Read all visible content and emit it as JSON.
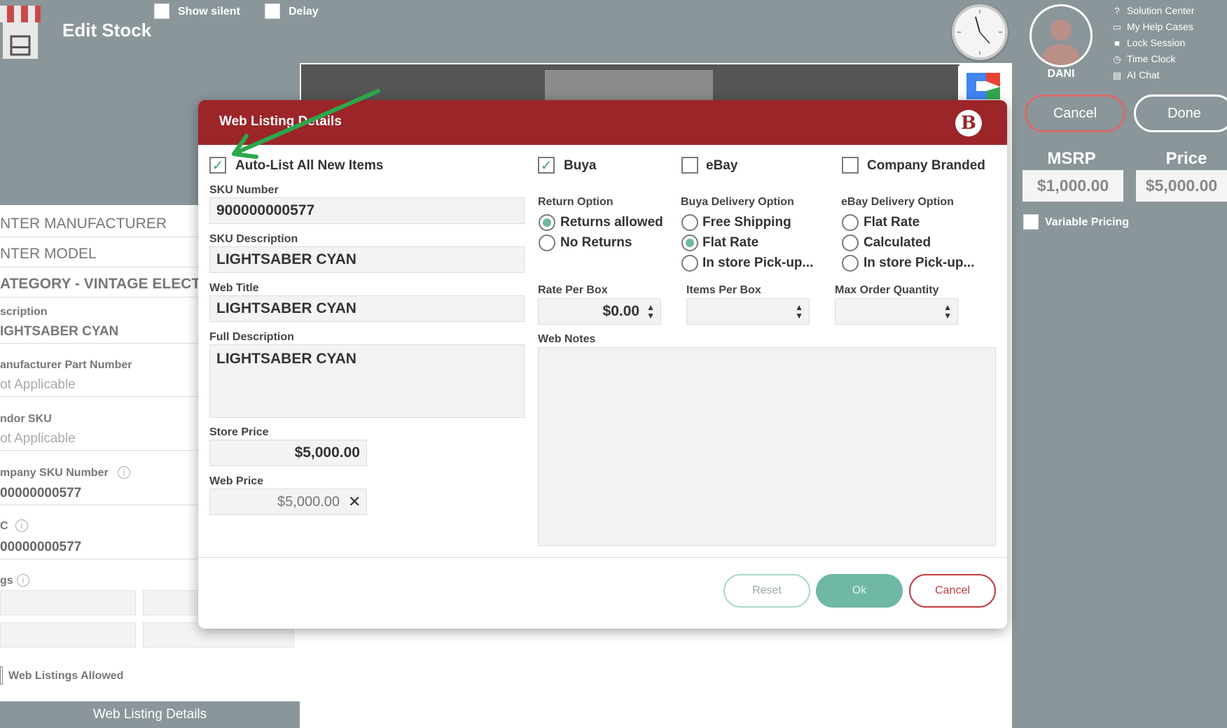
{
  "topbar": {
    "title": "Edit Stock",
    "show_silent_label": "Show silent",
    "delay_label": "Delay",
    "user_name": "DANI",
    "help_links": [
      "Solution Center",
      "My Help Cases",
      "Lock Session",
      "Time Clock",
      "AI Chat"
    ],
    "cancel_label": "Cancel",
    "done_label": "Done",
    "msrp_label": "MSRP",
    "msrp_value": "$1,000.00",
    "price_label": "Price",
    "price_value": "$5,000.00",
    "variable_pricing_label": "Variable Pricing"
  },
  "background_form": {
    "manufacturer": "NTER MANUFACTURER",
    "model": "NTER MODEL",
    "category": "ATEGORY - VINTAGE ELECTRONICS",
    "description_label": "scription",
    "description_value": "IGHTSABER  CYAN",
    "mpn_label": "anufacturer Part Number",
    "mpn_value": "ot Applicable",
    "vendor_sku_label": "ndor SKU",
    "vendor_sku_value": "ot Applicable",
    "company_sku_label": "mpany SKU Number",
    "company_sku_value": "00000000577",
    "upc_label": "C",
    "upc_value": "00000000577",
    "tags_label": "gs",
    "web_listings_label": "Web Listings Allowed",
    "web_listing_details_btn": "Web Listing Details"
  },
  "modal": {
    "title": "Web Listing Details",
    "logo_letter": "B",
    "auto_list_label": "Auto-List All New Items",
    "auto_list_checked": true,
    "buya_label": "Buya",
    "ebay_label": "eBay",
    "company_branded_label": "Company Branded",
    "sku_number_label": "SKU Number",
    "sku_number_value": "900000000577",
    "sku_desc_label": "SKU Description",
    "sku_desc_value": "LIGHTSABER  CYAN",
    "web_title_label": "Web Title",
    "web_title_value": "LIGHTSABER  CYAN",
    "full_desc_label": "Full Description",
    "full_desc_value": "LIGHTSABER  CYAN",
    "store_price_label": "Store Price",
    "store_price_value": "$5,000.00",
    "web_price_label": "Web Price",
    "web_price_value": "$5,000.00",
    "return_option_label": "Return Option",
    "returns_allowed": "Returns allowed",
    "no_returns": "No Returns",
    "buya_delivery_label": "Buya Delivery Option",
    "free_shipping": "Free Shipping",
    "flat_rate_buya": "Flat Rate",
    "instore_buya": "In store Pick-up...",
    "ebay_delivery_label": "eBay Delivery Option",
    "flat_rate_ebay": "Flat Rate",
    "calculated": "Calculated",
    "instore_ebay": "In store Pick-up...",
    "rate_per_box_label": "Rate Per Box",
    "rate_per_box_value": "$0.00",
    "items_per_box_label": "Items Per Box",
    "max_order_label": "Max Order Quantity",
    "web_notes_label": "Web Notes",
    "reset_label": "Reset",
    "ok_label": "Ok",
    "cancel_label": "Cancel"
  },
  "colors": {
    "accent_red": "#9b2529",
    "teal": "#6fb8a6",
    "annotation_arrow": "#2aa84a"
  }
}
